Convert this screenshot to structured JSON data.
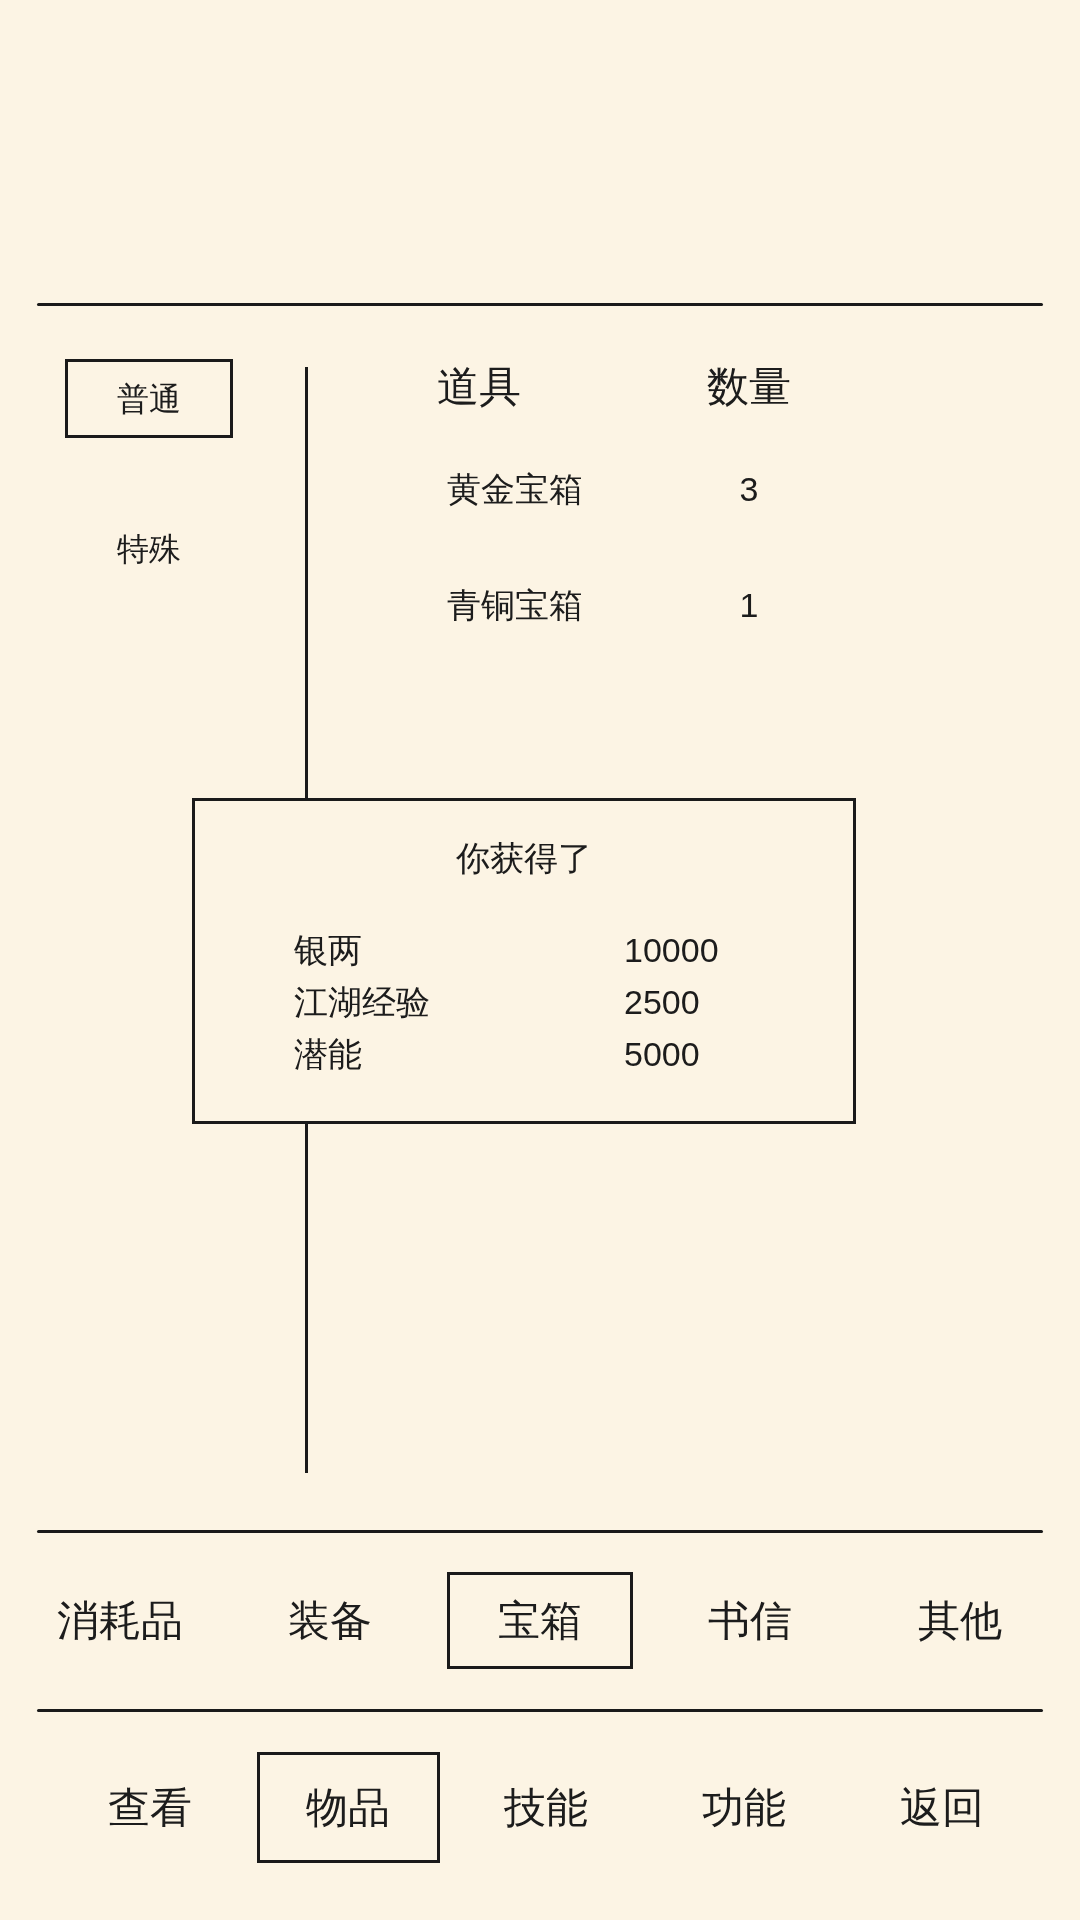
{
  "subcategories": [
    {
      "label": "普通",
      "selected": true
    },
    {
      "label": "特殊",
      "selected": false
    }
  ],
  "item_table": {
    "columns": [
      "道具",
      "数量"
    ],
    "rows": [
      {
        "item": "黄金宝箱",
        "quantity": "3"
      },
      {
        "item": "青铜宝箱",
        "quantity": "1"
      }
    ]
  },
  "reward_dialog": {
    "title": "你获得了",
    "rewards": [
      {
        "name": "银两",
        "amount": "10000"
      },
      {
        "name": "江湖经验",
        "amount": "2500"
      },
      {
        "name": "潜能",
        "amount": "5000"
      }
    ]
  },
  "category_tabs": [
    {
      "label": "消耗品",
      "selected": false
    },
    {
      "label": "装备",
      "selected": false
    },
    {
      "label": "宝箱",
      "selected": true
    },
    {
      "label": "书信",
      "selected": false
    },
    {
      "label": "其他",
      "selected": false
    }
  ],
  "bottom_nav": [
    {
      "label": "查看",
      "selected": false
    },
    {
      "label": "物品",
      "selected": true
    },
    {
      "label": "技能",
      "selected": false
    },
    {
      "label": "功能",
      "selected": false
    },
    {
      "label": "返回",
      "selected": false
    }
  ]
}
